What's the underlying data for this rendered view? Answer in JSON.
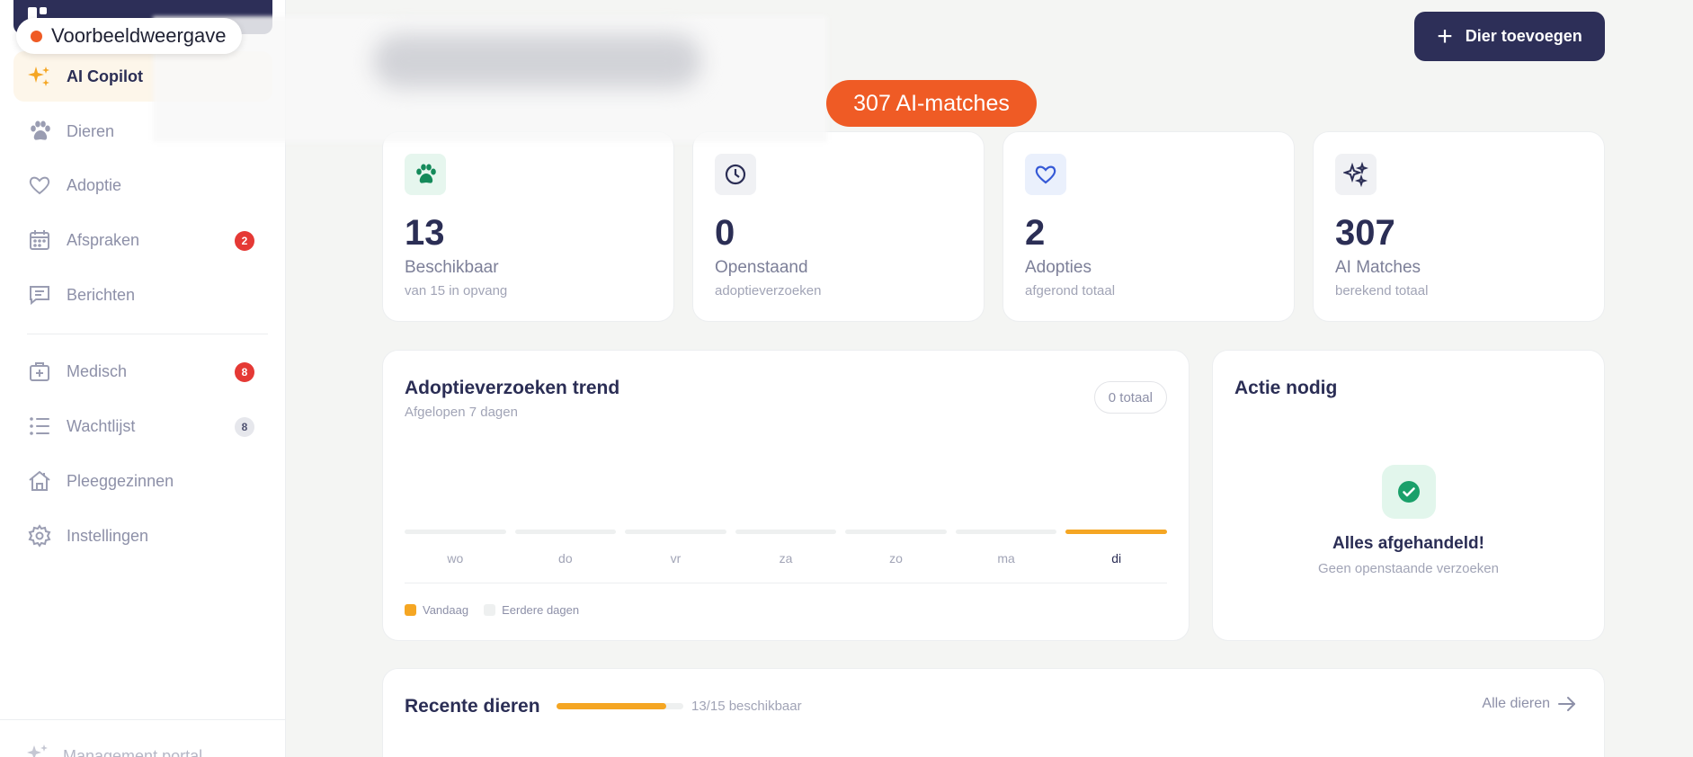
{
  "preview": {
    "label": "Voorbeeldweergave"
  },
  "header": {
    "add_button": "Dier toevoegen",
    "ai_badge": "307 AI-matches"
  },
  "sidebar": {
    "items": [
      {
        "label": "AI Copilot",
        "icon": "sparkles-icon",
        "active": true
      },
      {
        "label": "Dieren",
        "icon": "paw-icon"
      },
      {
        "label": "Adoptie",
        "icon": "heart-icon"
      },
      {
        "label": "Afspraken",
        "icon": "calendar-icon",
        "badge": "2"
      },
      {
        "label": "Berichten",
        "icon": "message-icon"
      },
      {
        "label": "Medisch",
        "icon": "medical-kit-icon",
        "badge": "8"
      },
      {
        "label": "Wachtlijst",
        "icon": "list-icon",
        "badge": "8"
      },
      {
        "label": "Pleeggezinnen",
        "icon": "home-icon"
      },
      {
        "label": "Instellingen",
        "icon": "gear-icon"
      }
    ],
    "bottom": {
      "label": "Management portal",
      "icon": "sparkles-icon"
    }
  },
  "stats": [
    {
      "value": "13",
      "label": "Beschikbaar",
      "sub": "van 15 in opvang",
      "icon": "paw-icon"
    },
    {
      "value": "0",
      "label": "Openstaand",
      "sub": "adoptieverzoeken",
      "icon": "clock-icon"
    },
    {
      "value": "2",
      "label": "Adopties",
      "sub": "afgerond totaal",
      "icon": "heart-icon"
    },
    {
      "value": "307",
      "label": "AI Matches",
      "sub": "berekend totaal",
      "icon": "sparkles-icon"
    }
  ],
  "trend": {
    "title": "Adoptieverzoeken trend",
    "subtitle": "Afgelopen 7 dagen",
    "total": "0 totaal",
    "legend": {
      "today": "Vandaag",
      "earlier": "Eerdere dagen"
    },
    "days": [
      {
        "label": "wo",
        "today": false
      },
      {
        "label": "do",
        "today": false
      },
      {
        "label": "vr",
        "today": false
      },
      {
        "label": "za",
        "today": false
      },
      {
        "label": "zo",
        "today": false
      },
      {
        "label": "ma",
        "today": false
      },
      {
        "label": "di",
        "today": true
      }
    ]
  },
  "action": {
    "title": "Actie nodig",
    "status_title": "Alles afgehandeld!",
    "status_sub": "Geen openstaande verzoeken"
  },
  "recent": {
    "title": "Recente dieren",
    "progress_label": "13/15 beschikbaar",
    "progress_fraction": 0.8667,
    "link": "Alle dieren"
  },
  "colors": {
    "navy": "#2d2f58",
    "orange": "#ef5b25",
    "amber": "#f5a623",
    "green": "#1aa06a"
  }
}
